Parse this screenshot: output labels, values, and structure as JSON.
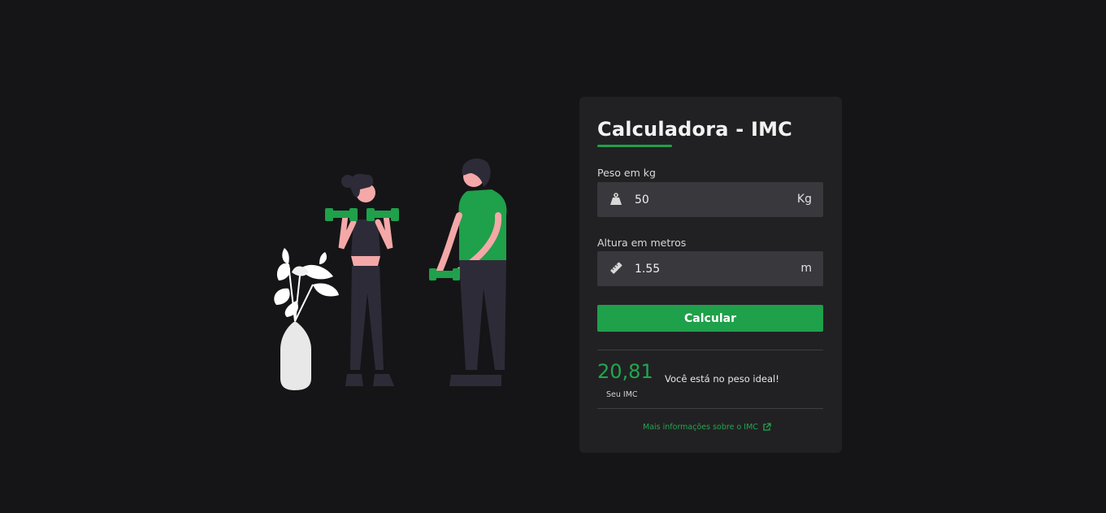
{
  "calculator": {
    "title": "Calculadora - IMC",
    "weight": {
      "label": "Peso em kg",
      "value": "50",
      "unit": "Kg",
      "icon": "weight-icon"
    },
    "height": {
      "label": "Altura em metros",
      "value": "1.55",
      "unit": "m",
      "icon": "ruler-icon"
    },
    "button_label": "Calcular",
    "result": {
      "value": "20,81",
      "caption": "Seu IMC",
      "message": "Você está no peso ideal!"
    },
    "more_info_link": "Mais informações sobre o IMC"
  },
  "colors": {
    "background": "#151517",
    "card": "#212123",
    "input": "#38383d",
    "accent": "#1fa04a"
  }
}
